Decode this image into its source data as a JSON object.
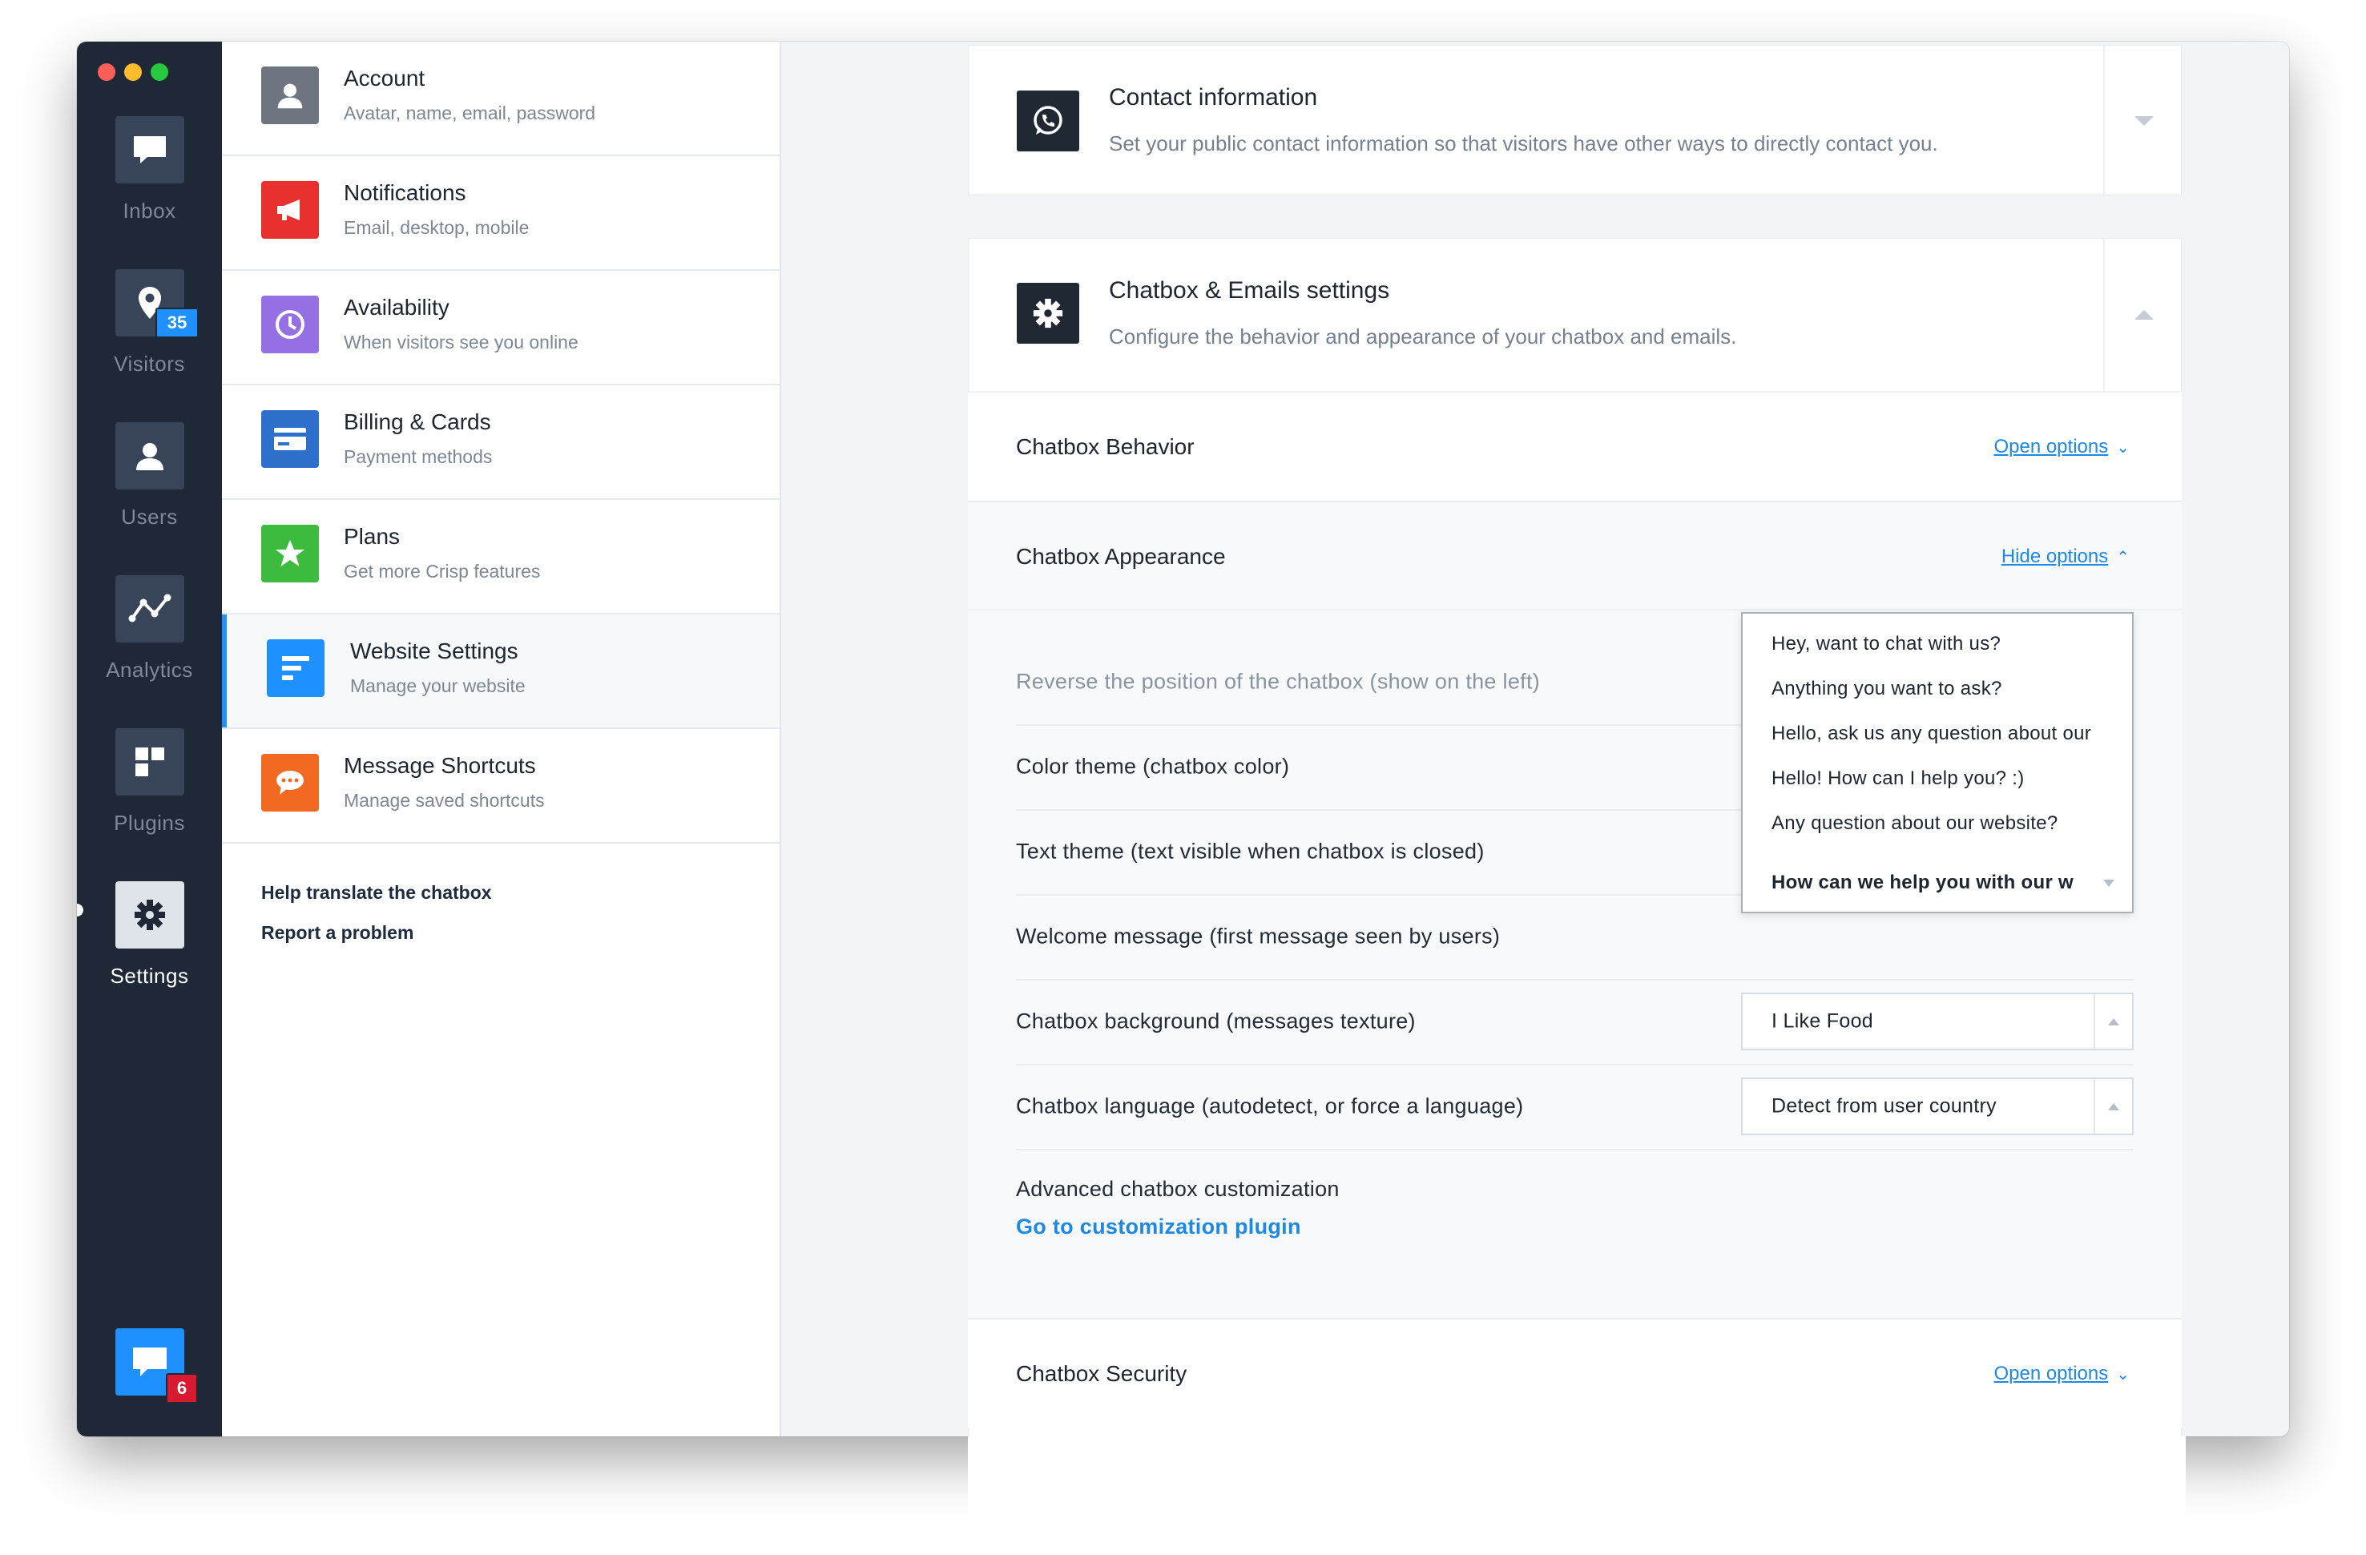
{
  "rail": {
    "items": [
      {
        "label": "Inbox",
        "icon": "chat-bubble-icon"
      },
      {
        "label": "Visitors",
        "icon": "location-pin-icon",
        "badge": "35"
      },
      {
        "label": "Users",
        "icon": "user-icon"
      },
      {
        "label": "Analytics",
        "icon": "analytics-icon"
      },
      {
        "label": "Plugins",
        "icon": "plugins-icon"
      },
      {
        "label": "Settings",
        "icon": "gear-icon"
      }
    ],
    "bottom_badge": "6"
  },
  "menu": {
    "items": [
      {
        "title": "Account",
        "subtitle": "Avatar, name, email, password"
      },
      {
        "title": "Notifications",
        "subtitle": "Email, desktop, mobile"
      },
      {
        "title": "Availability",
        "subtitle": "When visitors see you online"
      },
      {
        "title": "Billing & Cards",
        "subtitle": "Payment methods"
      },
      {
        "title": "Plans",
        "subtitle": "Get more Crisp features"
      },
      {
        "title": "Website Settings",
        "subtitle": "Manage your website"
      },
      {
        "title": "Message Shortcuts",
        "subtitle": "Manage saved shortcuts"
      }
    ],
    "links": [
      "Help translate the chatbox",
      "Report a problem"
    ]
  },
  "contact": {
    "title": "Contact information",
    "subtitle": "Set your public contact information so that visitors have other ways to directly contact you."
  },
  "chatbox": {
    "title": "Chatbox & Emails settings",
    "subtitle": "Configure the behavior and appearance of your chatbox and emails.",
    "sections": {
      "behavior": {
        "title": "Chatbox Behavior",
        "action": "Open options"
      },
      "appearance": {
        "title": "Chatbox Appearance",
        "action": "Hide options"
      },
      "security": {
        "title": "Chatbox Security",
        "action": "Open options"
      }
    },
    "options": [
      "Reverse the position of the chatbox (show on the left)",
      "Color theme (chatbox color)",
      "Text theme (text visible when chatbox is closed)",
      "Welcome message (first message seen by users)",
      "Chatbox background (messages texture)",
      "Chatbox language (autodetect, or force a language)"
    ],
    "welcome_dropdown": {
      "options": [
        "Hey, want to chat with us?",
        "Anything you want to ask?",
        "Hello, ask us any question about our",
        "Hello! How can I help you? :)",
        "Any question about our website?"
      ],
      "selected": "How can we help you with our w"
    },
    "background_select": {
      "value": "I Like Food"
    },
    "language_select": {
      "value": "Detect from user country"
    },
    "advanced_label": "Advanced chatbox customization",
    "advanced_link": "Go to customization plugin"
  },
  "colors": {
    "rail_bg": "#1e2836",
    "accent_blue": "#1e88e5",
    "badge_blue": "#1e90ff",
    "badge_red": "#d9192f"
  }
}
